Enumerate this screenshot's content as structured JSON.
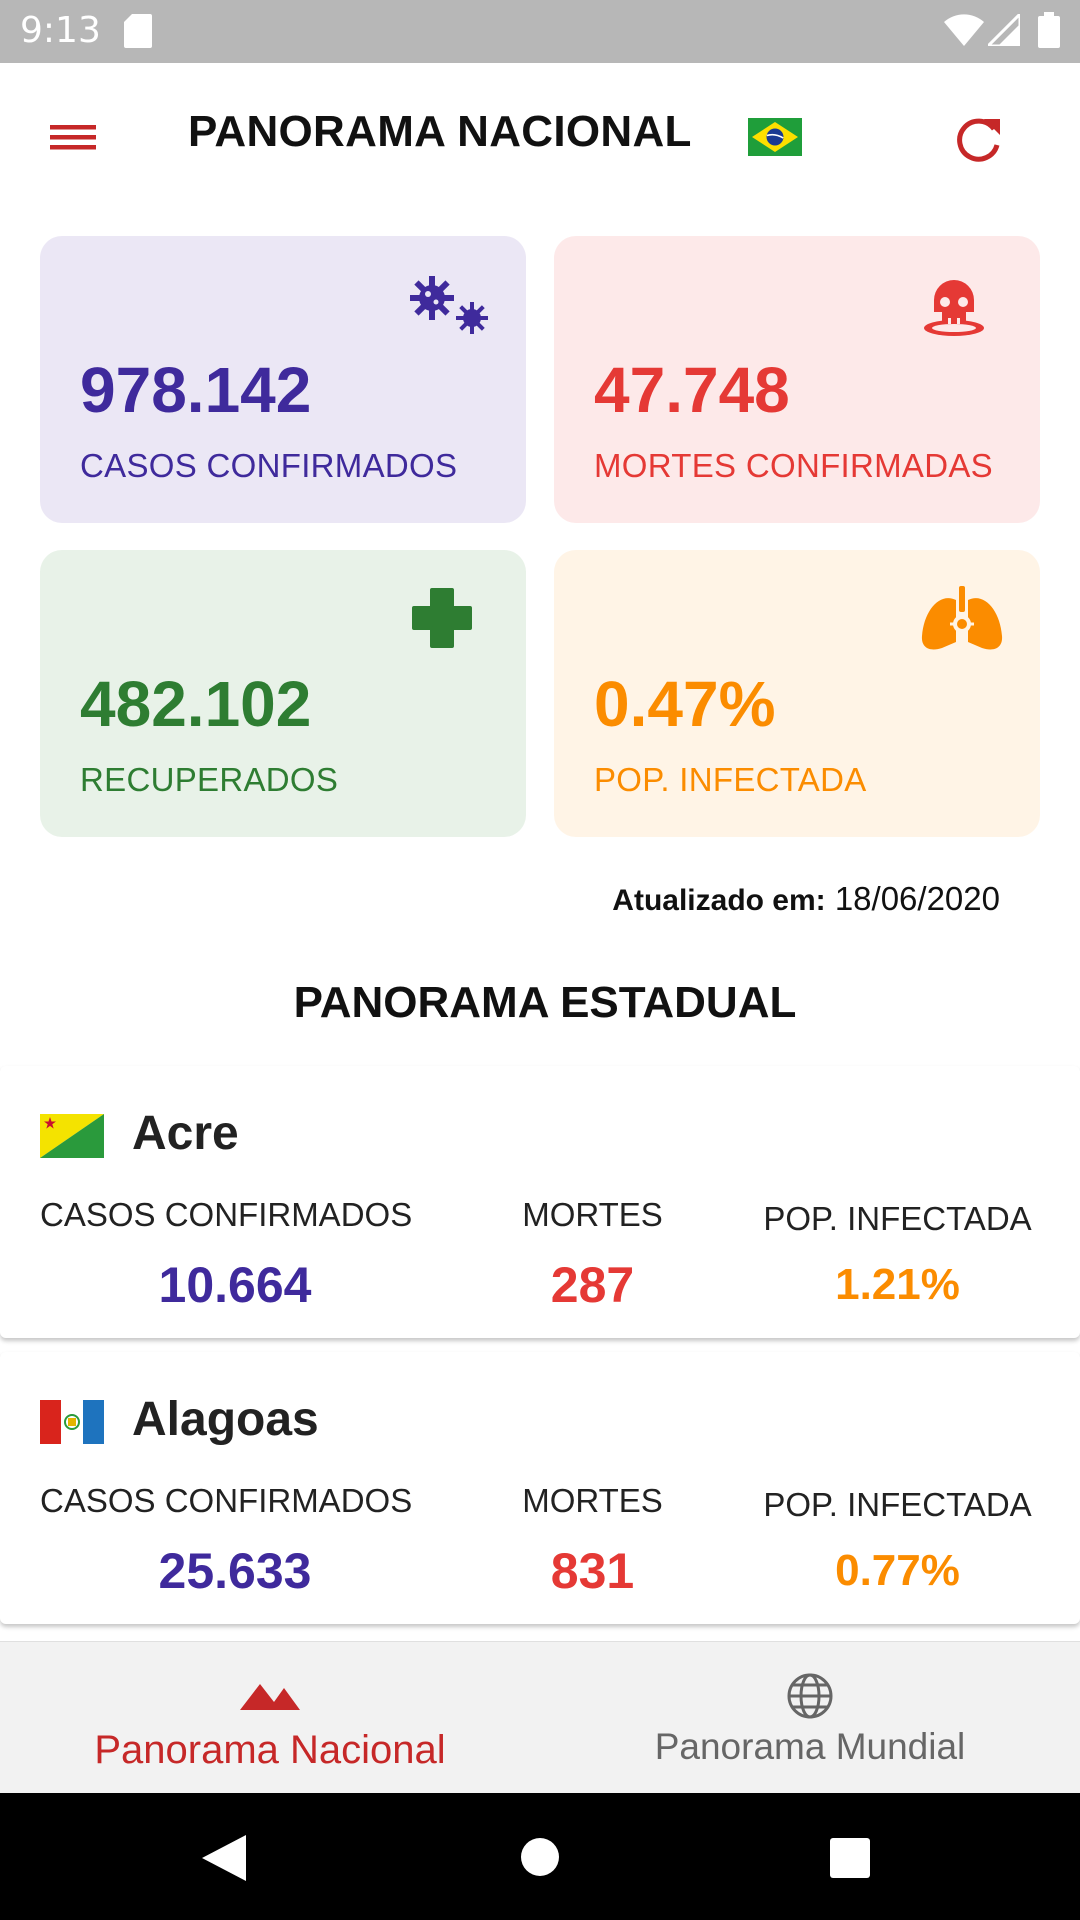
{
  "status_bar": {
    "time": "9:13"
  },
  "header": {
    "title": "PANORAMA NACIONAL"
  },
  "stats": {
    "cases": {
      "value": "978.142",
      "label": "CASOS CONFIRMADOS"
    },
    "deaths": {
      "value": "47.748",
      "label": "MORTES CONFIRMADAS"
    },
    "recovered": {
      "value": "482.102",
      "label": "RECUPERADOS"
    },
    "infected": {
      "value": "0.47%",
      "label": "POP. INFECTADA"
    }
  },
  "updated": {
    "label": "Atualizado em:",
    "date": "18/06/2020"
  },
  "section_title": "PANORAMA ESTADUAL",
  "states": [
    {
      "name": "Acre",
      "cases_label": "CASOS CONFIRMADOS",
      "cases": "10.664",
      "deaths_label": "MORTES",
      "deaths": "287",
      "infected_label": "POP. INFECTADA",
      "infected": "1.21%"
    },
    {
      "name": "Alagoas",
      "cases_label": "CASOS CONFIRMADOS",
      "cases": "25.633",
      "deaths_label": "MORTES",
      "deaths": "831",
      "infected_label": "POP. INFECTADA",
      "infected": "0.77%"
    }
  ],
  "bottom_nav": {
    "national": "Panorama Nacional",
    "world": "Panorama Mundial"
  },
  "colors": {
    "primary": "#c62828",
    "cases": "#3f2a9c",
    "deaths": "#e53935",
    "recovered": "#2e7d32",
    "infected": "#fb8c00"
  }
}
